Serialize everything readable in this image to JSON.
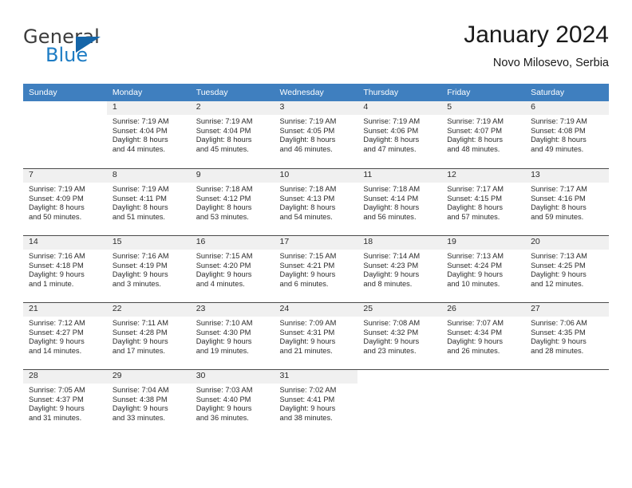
{
  "brand": {
    "name_part1": "General",
    "name_part2": "Blue",
    "logo_icon": "triangle-icon"
  },
  "header": {
    "title": "January 2024",
    "location": "Novo Milosevo, Serbia"
  },
  "colors": {
    "header_row": "#3f7fbf",
    "brand_blue": "#1d7cc4",
    "daynum_bg": "#f0f0f0",
    "cell_border": "#4a4a4a"
  },
  "calendar": {
    "weekdays": [
      "Sunday",
      "Monday",
      "Tuesday",
      "Wednesday",
      "Thursday",
      "Friday",
      "Saturday"
    ],
    "weeks": [
      [
        {
          "day": "",
          "sunrise": "",
          "sunset": "",
          "daylight_line1": "",
          "daylight_line2": "",
          "blank": true
        },
        {
          "day": "1",
          "sunrise": "Sunrise: 7:19 AM",
          "sunset": "Sunset: 4:04 PM",
          "daylight_line1": "Daylight: 8 hours",
          "daylight_line2": "and 44 minutes."
        },
        {
          "day": "2",
          "sunrise": "Sunrise: 7:19 AM",
          "sunset": "Sunset: 4:04 PM",
          "daylight_line1": "Daylight: 8 hours",
          "daylight_line2": "and 45 minutes."
        },
        {
          "day": "3",
          "sunrise": "Sunrise: 7:19 AM",
          "sunset": "Sunset: 4:05 PM",
          "daylight_line1": "Daylight: 8 hours",
          "daylight_line2": "and 46 minutes."
        },
        {
          "day": "4",
          "sunrise": "Sunrise: 7:19 AM",
          "sunset": "Sunset: 4:06 PM",
          "daylight_line1": "Daylight: 8 hours",
          "daylight_line2": "and 47 minutes."
        },
        {
          "day": "5",
          "sunrise": "Sunrise: 7:19 AM",
          "sunset": "Sunset: 4:07 PM",
          "daylight_line1": "Daylight: 8 hours",
          "daylight_line2": "and 48 minutes."
        },
        {
          "day": "6",
          "sunrise": "Sunrise: 7:19 AM",
          "sunset": "Sunset: 4:08 PM",
          "daylight_line1": "Daylight: 8 hours",
          "daylight_line2": "and 49 minutes."
        }
      ],
      [
        {
          "day": "7",
          "sunrise": "Sunrise: 7:19 AM",
          "sunset": "Sunset: 4:09 PM",
          "daylight_line1": "Daylight: 8 hours",
          "daylight_line2": "and 50 minutes."
        },
        {
          "day": "8",
          "sunrise": "Sunrise: 7:19 AM",
          "sunset": "Sunset: 4:11 PM",
          "daylight_line1": "Daylight: 8 hours",
          "daylight_line2": "and 51 minutes."
        },
        {
          "day": "9",
          "sunrise": "Sunrise: 7:18 AM",
          "sunset": "Sunset: 4:12 PM",
          "daylight_line1": "Daylight: 8 hours",
          "daylight_line2": "and 53 minutes."
        },
        {
          "day": "10",
          "sunrise": "Sunrise: 7:18 AM",
          "sunset": "Sunset: 4:13 PM",
          "daylight_line1": "Daylight: 8 hours",
          "daylight_line2": "and 54 minutes."
        },
        {
          "day": "11",
          "sunrise": "Sunrise: 7:18 AM",
          "sunset": "Sunset: 4:14 PM",
          "daylight_line1": "Daylight: 8 hours",
          "daylight_line2": "and 56 minutes."
        },
        {
          "day": "12",
          "sunrise": "Sunrise: 7:17 AM",
          "sunset": "Sunset: 4:15 PM",
          "daylight_line1": "Daylight: 8 hours",
          "daylight_line2": "and 57 minutes."
        },
        {
          "day": "13",
          "sunrise": "Sunrise: 7:17 AM",
          "sunset": "Sunset: 4:16 PM",
          "daylight_line1": "Daylight: 8 hours",
          "daylight_line2": "and 59 minutes."
        }
      ],
      [
        {
          "day": "14",
          "sunrise": "Sunrise: 7:16 AM",
          "sunset": "Sunset: 4:18 PM",
          "daylight_line1": "Daylight: 9 hours",
          "daylight_line2": "and 1 minute."
        },
        {
          "day": "15",
          "sunrise": "Sunrise: 7:16 AM",
          "sunset": "Sunset: 4:19 PM",
          "daylight_line1": "Daylight: 9 hours",
          "daylight_line2": "and 3 minutes."
        },
        {
          "day": "16",
          "sunrise": "Sunrise: 7:15 AM",
          "sunset": "Sunset: 4:20 PM",
          "daylight_line1": "Daylight: 9 hours",
          "daylight_line2": "and 4 minutes."
        },
        {
          "day": "17",
          "sunrise": "Sunrise: 7:15 AM",
          "sunset": "Sunset: 4:21 PM",
          "daylight_line1": "Daylight: 9 hours",
          "daylight_line2": "and 6 minutes."
        },
        {
          "day": "18",
          "sunrise": "Sunrise: 7:14 AM",
          "sunset": "Sunset: 4:23 PM",
          "daylight_line1": "Daylight: 9 hours",
          "daylight_line2": "and 8 minutes."
        },
        {
          "day": "19",
          "sunrise": "Sunrise: 7:13 AM",
          "sunset": "Sunset: 4:24 PM",
          "daylight_line1": "Daylight: 9 hours",
          "daylight_line2": "and 10 minutes."
        },
        {
          "day": "20",
          "sunrise": "Sunrise: 7:13 AM",
          "sunset": "Sunset: 4:25 PM",
          "daylight_line1": "Daylight: 9 hours",
          "daylight_line2": "and 12 minutes."
        }
      ],
      [
        {
          "day": "21",
          "sunrise": "Sunrise: 7:12 AM",
          "sunset": "Sunset: 4:27 PM",
          "daylight_line1": "Daylight: 9 hours",
          "daylight_line2": "and 14 minutes."
        },
        {
          "day": "22",
          "sunrise": "Sunrise: 7:11 AM",
          "sunset": "Sunset: 4:28 PM",
          "daylight_line1": "Daylight: 9 hours",
          "daylight_line2": "and 17 minutes."
        },
        {
          "day": "23",
          "sunrise": "Sunrise: 7:10 AM",
          "sunset": "Sunset: 4:30 PM",
          "daylight_line1": "Daylight: 9 hours",
          "daylight_line2": "and 19 minutes."
        },
        {
          "day": "24",
          "sunrise": "Sunrise: 7:09 AM",
          "sunset": "Sunset: 4:31 PM",
          "daylight_line1": "Daylight: 9 hours",
          "daylight_line2": "and 21 minutes."
        },
        {
          "day": "25",
          "sunrise": "Sunrise: 7:08 AM",
          "sunset": "Sunset: 4:32 PM",
          "daylight_line1": "Daylight: 9 hours",
          "daylight_line2": "and 23 minutes."
        },
        {
          "day": "26",
          "sunrise": "Sunrise: 7:07 AM",
          "sunset": "Sunset: 4:34 PM",
          "daylight_line1": "Daylight: 9 hours",
          "daylight_line2": "and 26 minutes."
        },
        {
          "day": "27",
          "sunrise": "Sunrise: 7:06 AM",
          "sunset": "Sunset: 4:35 PM",
          "daylight_line1": "Daylight: 9 hours",
          "daylight_line2": "and 28 minutes."
        }
      ],
      [
        {
          "day": "28",
          "sunrise": "Sunrise: 7:05 AM",
          "sunset": "Sunset: 4:37 PM",
          "daylight_line1": "Daylight: 9 hours",
          "daylight_line2": "and 31 minutes."
        },
        {
          "day": "29",
          "sunrise": "Sunrise: 7:04 AM",
          "sunset": "Sunset: 4:38 PM",
          "daylight_line1": "Daylight: 9 hours",
          "daylight_line2": "and 33 minutes."
        },
        {
          "day": "30",
          "sunrise": "Sunrise: 7:03 AM",
          "sunset": "Sunset: 4:40 PM",
          "daylight_line1": "Daylight: 9 hours",
          "daylight_line2": "and 36 minutes."
        },
        {
          "day": "31",
          "sunrise": "Sunrise: 7:02 AM",
          "sunset": "Sunset: 4:41 PM",
          "daylight_line1": "Daylight: 9 hours",
          "daylight_line2": "and 38 minutes."
        },
        {
          "day": "",
          "sunrise": "",
          "sunset": "",
          "daylight_line1": "",
          "daylight_line2": "",
          "blank": true
        },
        {
          "day": "",
          "sunrise": "",
          "sunset": "",
          "daylight_line1": "",
          "daylight_line2": "",
          "blank": true
        },
        {
          "day": "",
          "sunrise": "",
          "sunset": "",
          "daylight_line1": "",
          "daylight_line2": "",
          "blank": true
        }
      ]
    ]
  }
}
